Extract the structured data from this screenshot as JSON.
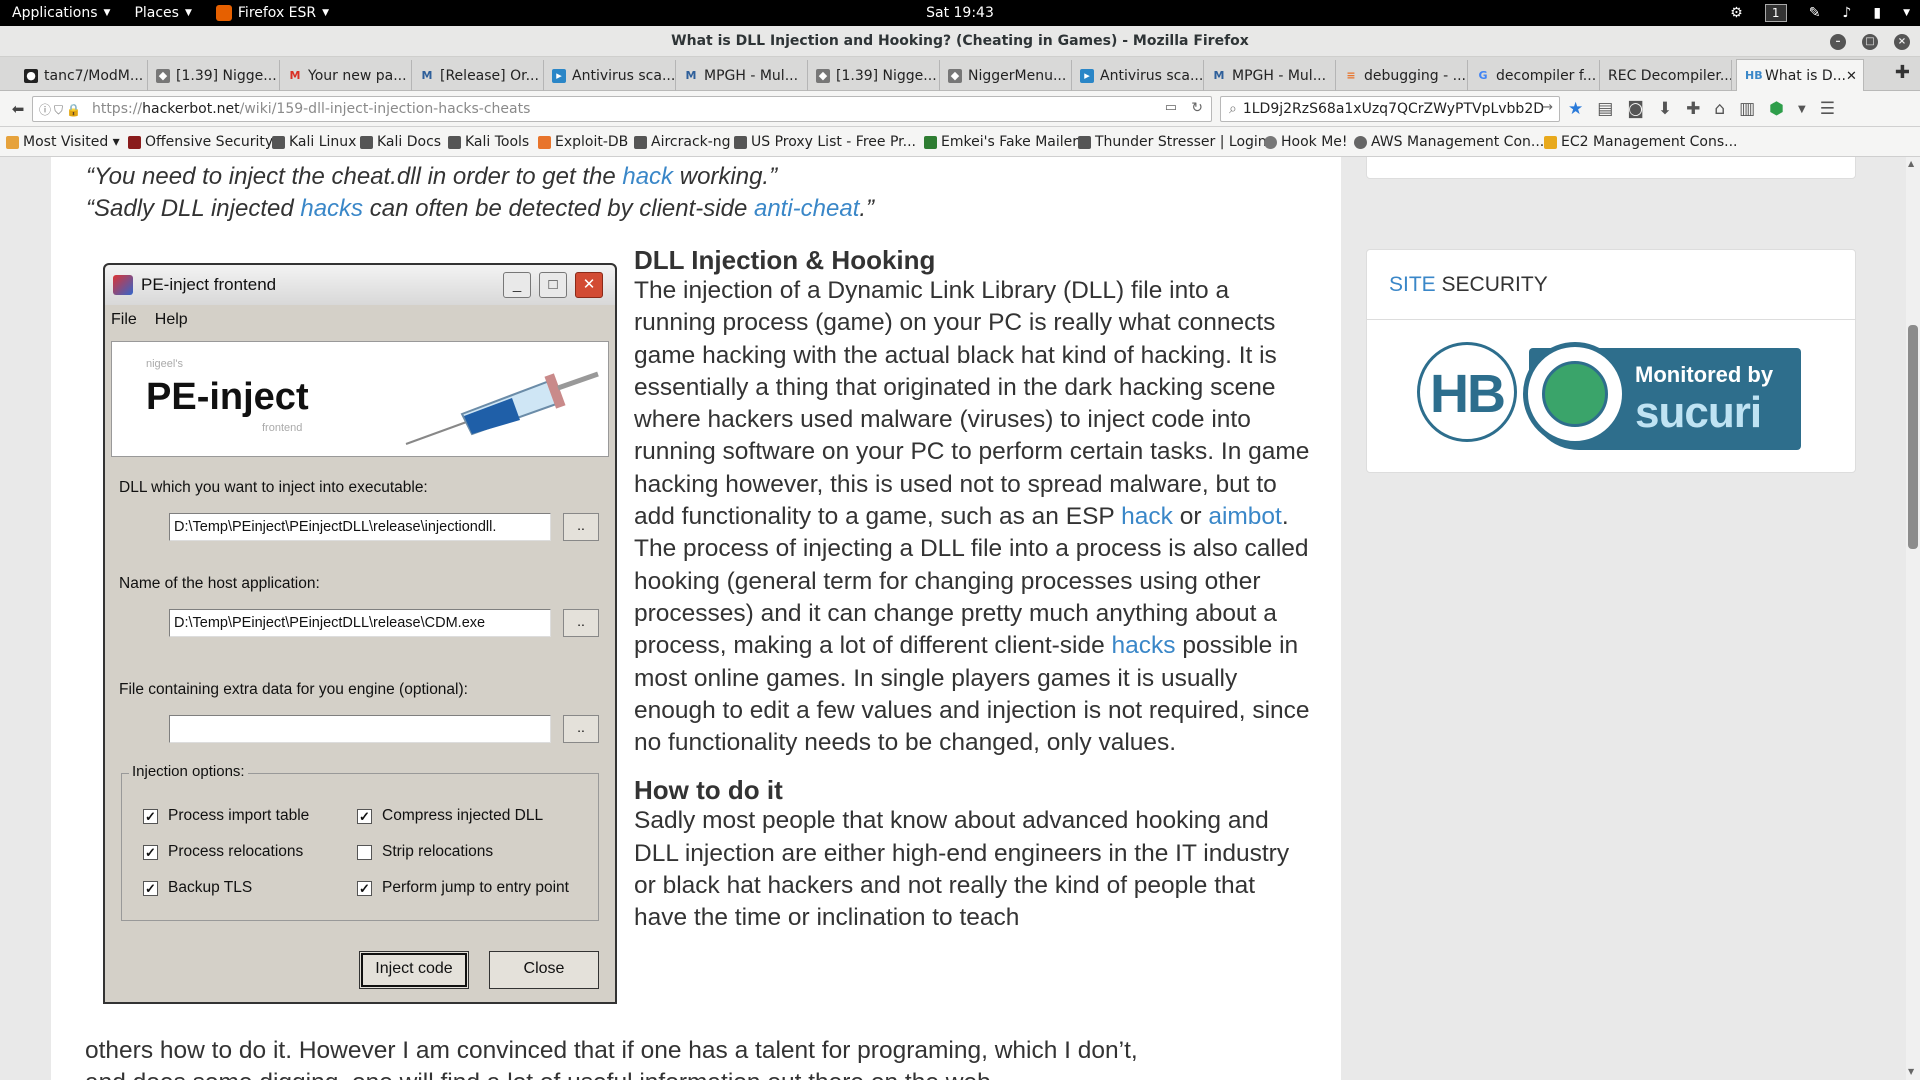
{
  "topbar": {
    "applications": "Applications",
    "places": "Places",
    "app_name": "Firefox ESR",
    "clock": "Sat 19:43",
    "workspace": "1"
  },
  "window": {
    "title": "What is DLL Injection and Hooking? (Cheating in Games) - Mozilla Firefox"
  },
  "tabs": [
    {
      "label": "tanc7/ModM...",
      "icon": "github-icon"
    },
    {
      "label": "[1.39] Nigge...",
      "icon": "mpgh-icon"
    },
    {
      "label": "Your new pa...",
      "icon": "gmail-icon"
    },
    {
      "label": "[Release] Or...",
      "icon": "mpgh-icon"
    },
    {
      "label": "Antivirus sca...",
      "icon": "scan-icon"
    },
    {
      "label": "MPGH - Mul...",
      "icon": "mpgh-icon"
    },
    {
      "label": "[1.39] Nigge...",
      "icon": "mpgh-icon"
    },
    {
      "label": "NiggerMenu...",
      "icon": "mpgh-icon"
    },
    {
      "label": "Antivirus sca...",
      "icon": "scan-icon"
    },
    {
      "label": "MPGH - Mul...",
      "icon": "mpgh-icon"
    },
    {
      "label": "debugging - ...",
      "icon": "stackoverflow-icon"
    },
    {
      "label": "decompiler f...",
      "icon": "google-icon"
    },
    {
      "label": "REC Decompiler...",
      "icon": "blank-icon"
    },
    {
      "label": "What is D...",
      "icon": "hackerbot-icon",
      "active": true
    }
  ],
  "navbar": {
    "url_prefix": "https://",
    "url_host": "hackerbot.net",
    "url_path": "/wiki/159-dll-inject-injection-hacks-cheats",
    "search_value": "1LD9j2RzS68a1xUzq7QCrZWyPTVpLvbb2D"
  },
  "bookmarks": [
    {
      "label": "Most Visited ▾",
      "color": "#e6a23c"
    },
    {
      "label": "Offensive Security",
      "color": "#8a1c1c"
    },
    {
      "label": "Kali Linux",
      "color": "#555555"
    },
    {
      "label": "Kali Docs",
      "color": "#555555"
    },
    {
      "label": "Kali Tools",
      "color": "#555555"
    },
    {
      "label": "Exploit-DB",
      "color": "#e8742b"
    },
    {
      "label": "Aircrack-ng",
      "color": "#555555"
    },
    {
      "label": "US Proxy List - Free Pr...",
      "color": "#555555"
    },
    {
      "label": "Emkei's Fake Mailer",
      "color": "#2e7d32"
    },
    {
      "label": "Thunder Stresser | Login",
      "color": "#555555"
    },
    {
      "label": "Hook Me!",
      "color": "#777777"
    },
    {
      "label": "AWS Management Con...",
      "color": "#666666"
    },
    {
      "label": "EC2 Management Cons...",
      "color": "#e8a91c"
    }
  ],
  "quotes": {
    "q1_pre": "“You need to inject the cheat.dll in order to get the ",
    "q1_link": "hack",
    "q1_post": " working.”",
    "q2_pre": "“Sadly DLL injected ",
    "q2_link1": "hacks",
    "q2_mid": " can often be detected by client-side ",
    "q2_link2": "anti-cheat",
    "q2_post": ".”"
  },
  "article": {
    "h1": "DLL Injection & Hooking",
    "p1_a": "The injection of a Dynamic Link Library (DLL) file into a running process (game) on your PC is really what connects game hacking with the actual black hat kind of hacking. It is essentially a thing that originated in the dark hacking scene where hackers used malware (viruses) to inject code into running software on your PC to perform certain tasks. In game hacking however, this is used not to spread malware, but to add functionality to a game, such as an ESP ",
    "p1_link1": "hack",
    "p1_b": " or ",
    "p1_link2": "aimbot",
    "p1_c": ". The process of injecting a DLL file into a process is also called hooking (general term for changing processes using other processes) and it can change pretty much anything about a process, making a lot of different client-side ",
    "p1_link3": "hacks",
    "p1_d": " possible in most online games. In single players games it is usually enough to edit a few values and injection is not required, since no functionality needs to be changed, only values.",
    "h2": "How to do it",
    "p2": "Sadly most people that know about advanced hooking and DLL injection are either high-end engineers in the IT industry or black hat hackers and not really the kind of people that have the time or inclination to teach",
    "p2_cont": "others how to do it. However I am convinced that if one has a talent for programing, which I don’t,",
    "p2_cont2": "and does some digging, one will find a lot of useful information out there on the web."
  },
  "pe_window": {
    "title": "PE-inject frontend",
    "menu_file": "File",
    "menu_help": "Help",
    "banner_small": "nigeel's",
    "banner_big": "PE-inject",
    "banner_sub": "frontend",
    "dll_label": "DLL which you want to inject into executable:",
    "dll_value": "D:\\Temp\\PEinject\\PEinjectDLL\\release\\injectiondll.",
    "host_label": "Name of the host application:",
    "host_value": "D:\\Temp\\PEinject\\PEinjectDLL\\release\\CDM.exe",
    "extra_label": "File containing extra data for you engine (optional):",
    "extra_value": "",
    "browse": "..",
    "options_label": "Injection options:",
    "options": [
      {
        "label": "Process import table",
        "checked": true
      },
      {
        "label": "Compress injected DLL",
        "checked": true
      },
      {
        "label": "Process relocations",
        "checked": true
      },
      {
        "label": "Strip relocations",
        "checked": false
      },
      {
        "label": "Backup TLS",
        "checked": true
      },
      {
        "label": "Perform jump to entry point",
        "checked": true
      }
    ],
    "inject_button": "Inject code",
    "close_button": "Close"
  },
  "sidebar": {
    "security_accent": "SITE",
    "security_rest": " SECURITY",
    "hb_logo": "HB",
    "sucuri_line1": "Monitored by",
    "sucuri_line2": "sucuri"
  }
}
